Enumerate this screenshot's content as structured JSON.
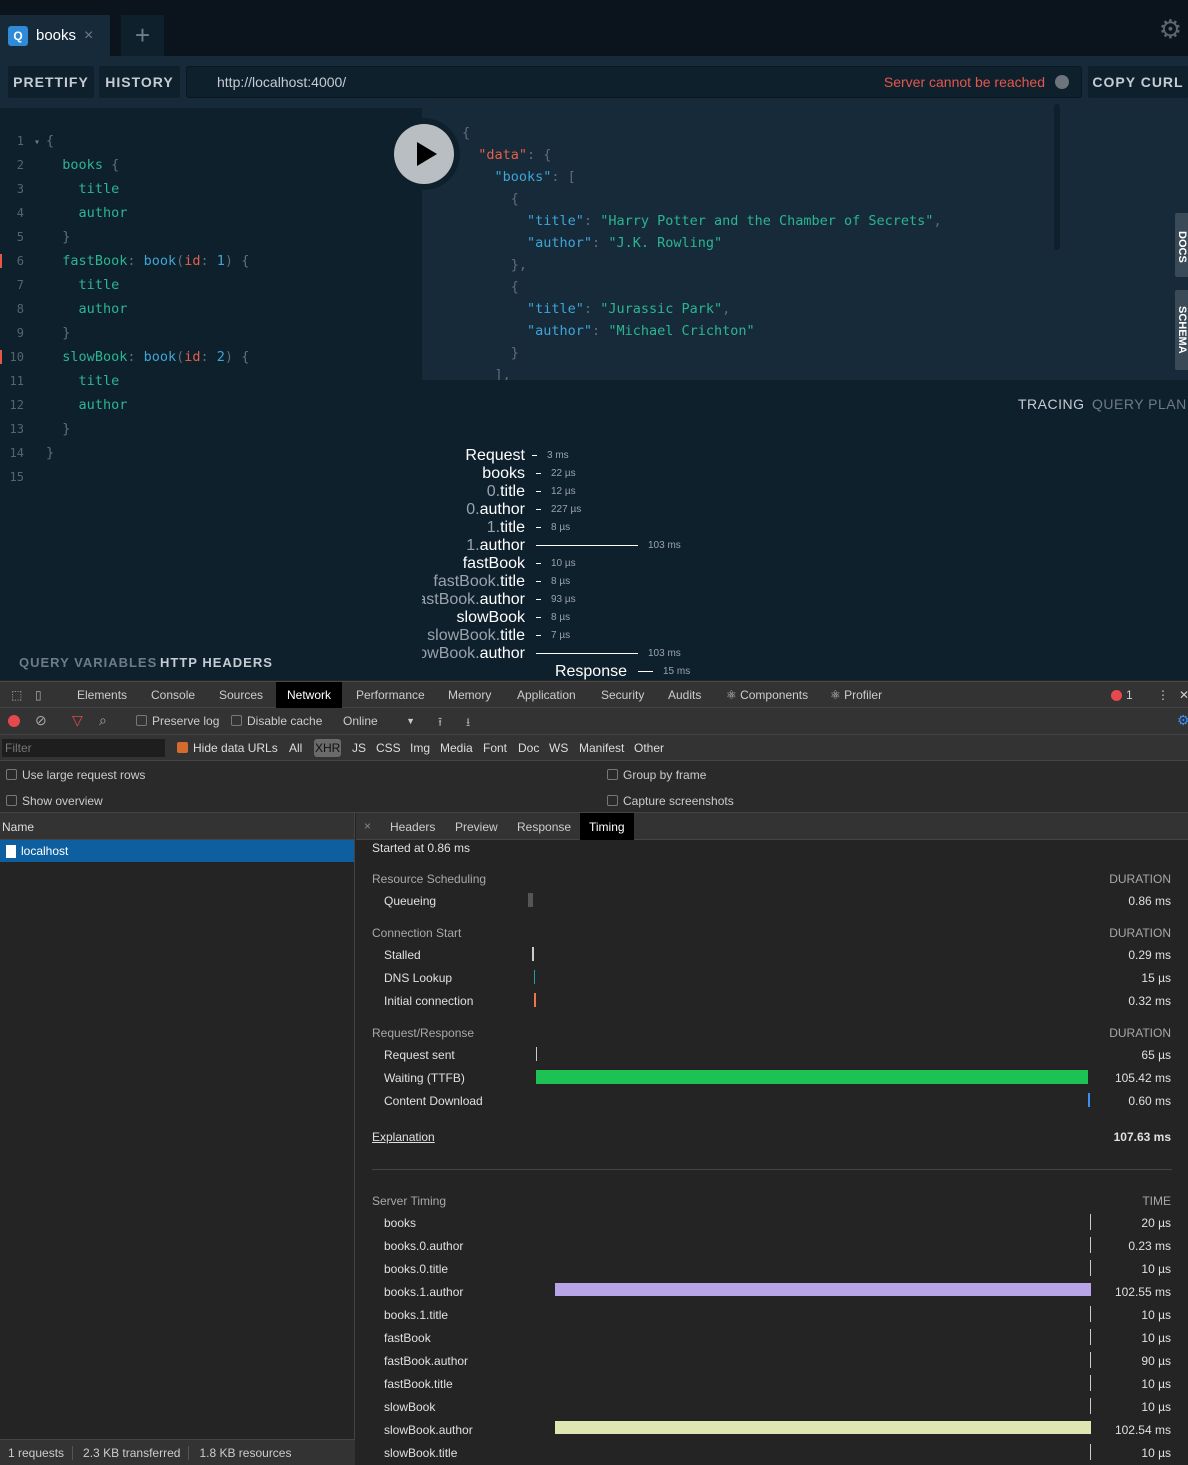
{
  "playground": {
    "tab": {
      "icon": "Q",
      "label": "books",
      "close": "×"
    },
    "new_tab": "+",
    "prettify": "PRETTIFY",
    "history": "HISTORY",
    "url": "http://localhost:4000/",
    "server_status": "Server cannot be reached",
    "copy_curl": "COPY CURL",
    "side_tabs": [
      "DOCS",
      "SCHEMA"
    ],
    "query_lines": [
      [
        [
          "b",
          "{"
        ]
      ],
      [
        [
          "f",
          "  books"
        ],
        [
          "b",
          " {"
        ]
      ],
      [
        [
          "f",
          "    title"
        ]
      ],
      [
        [
          "f",
          "    author"
        ]
      ],
      [
        [
          "b",
          "  }"
        ]
      ],
      [
        [
          "f",
          "  fastBook"
        ],
        [
          "p",
          ": "
        ],
        [
          "t",
          "book"
        ],
        [
          "p",
          "("
        ],
        [
          "a",
          "id"
        ],
        [
          "p",
          ": "
        ],
        [
          "n",
          "1"
        ],
        [
          "p",
          ") "
        ],
        [
          "b",
          "{"
        ]
      ],
      [
        [
          "f",
          "    title"
        ]
      ],
      [
        [
          "f",
          "    author"
        ]
      ],
      [
        [
          "b",
          "  }"
        ]
      ],
      [
        [
          "f",
          "  slowBook"
        ],
        [
          "p",
          ": "
        ],
        [
          "t",
          "book"
        ],
        [
          "p",
          "("
        ],
        [
          "a",
          "id"
        ],
        [
          "p",
          ": "
        ],
        [
          "n",
          "2"
        ],
        [
          "p",
          ") "
        ],
        [
          "b",
          "{"
        ]
      ],
      [
        [
          "f",
          "    title"
        ]
      ],
      [
        [
          "f",
          "    author"
        ]
      ],
      [
        [
          "b",
          "  }"
        ]
      ],
      [
        [
          "b",
          "}"
        ]
      ],
      []
    ],
    "error_lines": [
      6,
      10
    ],
    "result_lines": [
      {
        "fold": true,
        "segs": [
          [
            "p",
            "{"
          ]
        ]
      },
      {
        "fold": true,
        "segs": [
          [
            "k",
            "  \"data\""
          ],
          [
            "p",
            ": {"
          ]
        ]
      },
      {
        "fold": true,
        "segs": [
          [
            "n",
            "    \"books\""
          ],
          [
            "p",
            ": ["
          ]
        ]
      },
      {
        "segs": [
          [
            "p",
            "      {"
          ]
        ]
      },
      {
        "segs": [
          [
            "n",
            "        \"title\""
          ],
          [
            "p",
            ": "
          ],
          [
            "s",
            "\"Harry Potter and the Chamber of Secrets\""
          ],
          [
            "p",
            ","
          ]
        ]
      },
      {
        "segs": [
          [
            "n",
            "        \"author\""
          ],
          [
            "p",
            ": "
          ],
          [
            "s",
            "\"J.K. Rowling\""
          ]
        ]
      },
      {
        "segs": [
          [
            "p",
            "      },"
          ]
        ]
      },
      {
        "segs": [
          [
            "p",
            "      {"
          ]
        ]
      },
      {
        "segs": [
          [
            "n",
            "        \"title\""
          ],
          [
            "p",
            ": "
          ],
          [
            "s",
            "\"Jurassic Park\""
          ],
          [
            "p",
            ","
          ]
        ]
      },
      {
        "segs": [
          [
            "n",
            "        \"author\""
          ],
          [
            "p",
            ": "
          ],
          [
            "s",
            "\"Michael Crichton\""
          ]
        ]
      },
      {
        "segs": [
          [
            "p",
            "      }"
          ]
        ]
      },
      {
        "segs": [
          [
            "p",
            "    ],"
          ]
        ]
      }
    ],
    "tracing_tabs": [
      "TRACING",
      "QUERY PLAN"
    ],
    "tracing": [
      {
        "prefix": "",
        "name": "Request",
        "value": "3 ms",
        "ms": 3
      },
      {
        "prefix": "",
        "name": "books",
        "value": "22 µs",
        "ms": 0.022
      },
      {
        "prefix": "0.",
        "name": "title",
        "value": "12 µs",
        "ms": 0.012
      },
      {
        "prefix": "0.",
        "name": "author",
        "value": "227 µs",
        "ms": 0.227
      },
      {
        "prefix": "1.",
        "name": "title",
        "value": "8 µs",
        "ms": 0.008
      },
      {
        "prefix": "1.",
        "name": "author",
        "value": "103 ms",
        "ms": 103
      },
      {
        "prefix": "",
        "name": "fastBook",
        "value": "10 µs",
        "ms": 0.01
      },
      {
        "prefix": "fastBook.",
        "name": "title",
        "value": "8 µs",
        "ms": 0.008
      },
      {
        "prefix": "fastBook.",
        "name": "author",
        "value": "93 µs",
        "ms": 0.093
      },
      {
        "prefix": "",
        "name": "slowBook",
        "value": "8 µs",
        "ms": 0.008
      },
      {
        "prefix": "slowBook.",
        "name": "title",
        "value": "7 µs",
        "ms": 0.007
      },
      {
        "prefix": "slowBook.",
        "name": "author",
        "value": "103 ms",
        "ms": 103
      },
      {
        "prefix": "",
        "name": "Response",
        "value": "15 ms",
        "ms": 15
      }
    ],
    "bottom_tabs": [
      "QUERY VARIABLES",
      "HTTP HEADERS"
    ]
  },
  "devtools": {
    "tabs": [
      "Elements",
      "Console",
      "Sources",
      "Network",
      "Performance",
      "Memory",
      "Application",
      "Security",
      "Audits",
      "⚛ Components",
      "⚛ Profiler"
    ],
    "active_tab": "Network",
    "error_count": "1",
    "toolbar": {
      "preserve_log": "Preserve log",
      "disable_cache": "Disable cache",
      "throttle": "Online"
    },
    "filter_placeholder": "Filter",
    "hide_data_urls": "Hide data URLs",
    "types": [
      "All",
      "XHR",
      "JS",
      "CSS",
      "Img",
      "Media",
      "Font",
      "Doc",
      "WS",
      "Manifest",
      "Other"
    ],
    "active_type": "XHR",
    "options": {
      "large_rows": "Use large request rows",
      "show_overview": "Show overview",
      "group_by_frame": "Group by frame",
      "capture_screenshots": "Capture screenshots"
    },
    "name_header": "Name",
    "requests": [
      "localhost"
    ],
    "detail_tabs": [
      "Headers",
      "Preview",
      "Response",
      "Timing"
    ],
    "active_detail_tab": "Timing",
    "status": [
      "1 requests",
      "2.3 KB transferred",
      "1.8 KB resources"
    ],
    "timing": {
      "started": "Started at 0.86 ms",
      "duration_label": "DURATION",
      "sections": [
        {
          "title": "Resource Scheduling",
          "rows": [
            {
              "label": "Queueing",
              "value": "0.86 ms",
              "color": "#555555"
            }
          ]
        },
        {
          "title": "Connection Start",
          "rows": [
            {
              "label": "Stalled",
              "value": "0.29 ms",
              "color": "#cccccc"
            },
            {
              "label": "DNS Lookup",
              "value": "15 µs",
              "color": "#1ba29a"
            },
            {
              "label": "Initial connection",
              "value": "0.32 ms",
              "color": "#e8784a"
            }
          ]
        },
        {
          "title": "Request/Response",
          "rows": [
            {
              "label": "Request sent",
              "value": "65 µs",
              "color": "#cccccc"
            },
            {
              "label": "Waiting (TTFB)",
              "value": "105.42 ms",
              "color": "#1ec153"
            },
            {
              "label": "Content Download",
              "value": "0.60 ms",
              "color": "#3b8df0"
            }
          ]
        }
      ],
      "explanation": "Explanation",
      "total": "107.63 ms",
      "server_timing_title": "Server Timing",
      "time_label": "TIME",
      "server_timing": [
        {
          "label": "books",
          "value": "20 µs",
          "ms": 0.02
        },
        {
          "label": "books.0.author",
          "value": "0.23 ms",
          "ms": 0.23
        },
        {
          "label": "books.0.title",
          "value": "10 µs",
          "ms": 0.01
        },
        {
          "label": "books.1.author",
          "value": "102.55 ms",
          "ms": 102.55,
          "color": "#b8a5e8"
        },
        {
          "label": "books.1.title",
          "value": "10 µs",
          "ms": 0.01
        },
        {
          "label": "fastBook",
          "value": "10 µs",
          "ms": 0.01
        },
        {
          "label": "fastBook.author",
          "value": "90 µs",
          "ms": 0.09
        },
        {
          "label": "fastBook.title",
          "value": "10 µs",
          "ms": 0.01
        },
        {
          "label": "slowBook",
          "value": "10 µs",
          "ms": 0.01
        },
        {
          "label": "slowBook.author",
          "value": "102.54 ms",
          "ms": 102.54,
          "color": "#dfe6b1"
        },
        {
          "label": "slowBook.title",
          "value": "10 µs",
          "ms": 0.01
        }
      ]
    }
  }
}
